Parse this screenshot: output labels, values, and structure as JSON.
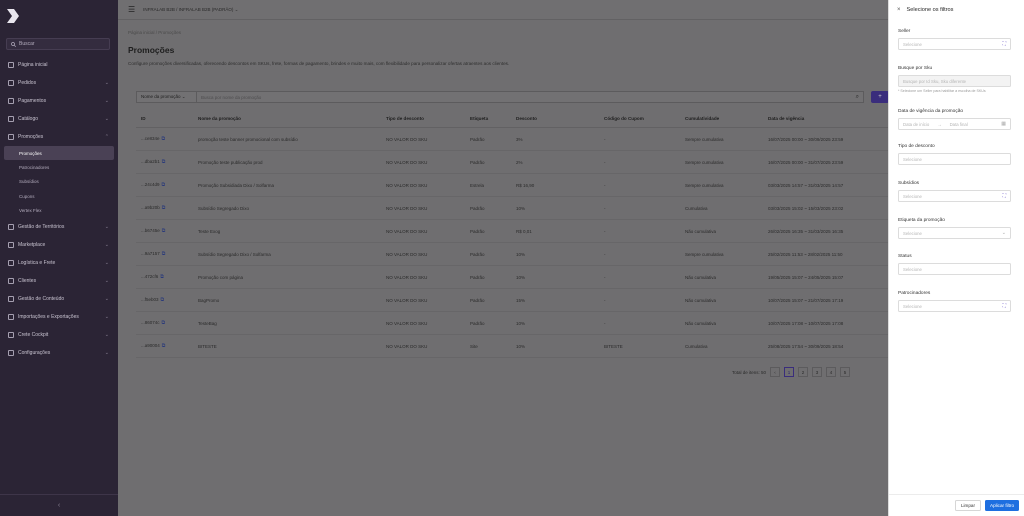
{
  "sidebar": {
    "search_label": "Buscar",
    "items": [
      {
        "label": "Página inicial",
        "icon": "home-icon",
        "chevron": false
      },
      {
        "label": "Pedidos",
        "icon": "receipt-icon",
        "chevron": true
      },
      {
        "label": "Pagamentos",
        "icon": "dollar-icon",
        "chevron": true
      },
      {
        "label": "Catálogo",
        "icon": "tag-icon",
        "chevron": true
      },
      {
        "label": "Promoções",
        "icon": "percent-icon",
        "chevron": true
      }
    ],
    "subitems": [
      {
        "label": "Promoções",
        "active": true
      },
      {
        "label": "Patrocinadores",
        "active": false
      },
      {
        "label": "Subsídios",
        "active": false
      },
      {
        "label": "Cupons",
        "active": false
      },
      {
        "label": "Vertex Flex",
        "active": false
      }
    ],
    "items2": [
      {
        "label": "Gestão de Territórios",
        "icon": "map-icon"
      },
      {
        "label": "Marketplace",
        "icon": "store-icon"
      },
      {
        "label": "Logística e Frete",
        "icon": "truck-icon"
      },
      {
        "label": "Clientes",
        "icon": "users-icon"
      },
      {
        "label": "Gestão de Conteúdo",
        "icon": "content-icon"
      },
      {
        "label": "Importações e Exportações",
        "icon": "file-icon"
      },
      {
        "label": "Crete Cockpit",
        "icon": "chat-icon"
      },
      {
        "label": "Configurações",
        "icon": "gear-icon"
      }
    ],
    "collapse_glyph": "‹"
  },
  "topbar": {
    "store_label": "INFRALAB B2B / INFRALAB B2B (PADRÃO) ⌄"
  },
  "page": {
    "breadcrumb": "Página inicial  /  Promoções",
    "title": "Promoções",
    "description": "Configure promoções diversificadas, oferecendo descontos em SKUs, frete, formas de pagamento, brindes e muito mais, com flexibilidade para personalizar ofertas atraentes aos clientes."
  },
  "filter": {
    "field_label": "Nome da promoção  ⌄",
    "placeholder": "Busca por nome da promoção",
    "search_glyph": "⌕",
    "button_glyph": "+"
  },
  "table": {
    "headers": [
      "ID",
      "Nome da promoção",
      "Tipo de desconto",
      "Etiqueta",
      "Desconto",
      "Código do Cupom",
      "Cumulatividade",
      "Data de vigência"
    ],
    "rows": [
      [
        "...ce834e",
        "promoção teste banner promocional com subsídio",
        "NO VALOR DO SKU",
        "Padrão",
        "3%",
        "-",
        "Sempre cumulativa",
        "16/07/2025 00:00 ~ 30/09/2025 23:59"
      ],
      [
        "...dba2b1",
        "Promoção teste publicação prod",
        "NO VALOR DO SKU",
        "Padrão",
        "2%",
        "-",
        "Sempre cumulativa",
        "16/07/2025 00:00 ~ 31/07/2025 23:59"
      ],
      [
        "...24c4d9",
        "Promoção Subsidiada Dixo / Solfarma",
        "NO VALOR DO SKU",
        "Estrela",
        "R$ 16,90",
        "-",
        "Sempre cumulativa",
        "03/03/2025 14:57 ~ 31/03/2025 14:57"
      ],
      [
        "...a9b20b",
        "Subsídio Segregado Dixo",
        "NO VALOR DO SKU",
        "Padrão",
        "10%",
        "-",
        "Cumulativa",
        "03/03/2025 15:02 ~ 15/03/2025 23:02"
      ],
      [
        "...b6745e",
        "Teste Exog",
        "NO VALOR DO SKU",
        "Padrão",
        "R$ 0,01",
        "-",
        "Não cumulativa",
        "26/02/2025 16:35 ~ 31/03/2025 16:35"
      ],
      [
        "...9a7157",
        "Subsídio Segregado Dixo / Solfarma",
        "NO VALOR DO SKU",
        "Padrão",
        "10%",
        "-",
        "Sempre cumulativa",
        "25/02/2025 11:53 ~ 28/02/2025 11:50"
      ],
      [
        "...472cf6",
        "Promoção com página",
        "NO VALOR DO SKU",
        "Padrão",
        "10%",
        "-",
        "Não cumulativa",
        "19/05/2025 15:07 ~ 24/05/2025 15:07"
      ],
      [
        "...f5eb03",
        "BagPromo",
        "NO VALOR DO SKU",
        "Padrão",
        "15%",
        "-",
        "Não cumulativa",
        "10/07/2025 15:07 ~ 21/07/2025 17:19"
      ],
      [
        "...86074c",
        "TesteBag",
        "NO VALOR DO SKU",
        "Padrão",
        "10%",
        "-",
        "Não cumulativa",
        "10/07/2025 17:08 ~ 10/07/2025 17:08"
      ],
      [
        "...a90004",
        "BITESTE",
        "NO VALOR DO SKU",
        "Site",
        "10%",
        "BITESTE",
        "Cumulativa",
        "25/08/2025 17:54 ~ 30/09/2025 18:54"
      ]
    ]
  },
  "pagination": {
    "total_label": "Total de itens: 50",
    "prev": "‹",
    "pages": [
      "1",
      "2",
      "3",
      "4",
      "5"
    ],
    "active_page": "1"
  },
  "drawer": {
    "title": "Selecione os filtros",
    "close_glyph": "×",
    "seller": {
      "label": "Seller",
      "placeholder": "Selecione"
    },
    "sku_search": {
      "label": "Busque por Sku",
      "placeholder": "Busque por Id Sku, Sku diferente",
      "hint": "* Selecione um Seller para habilitar a escolha de SKUs"
    },
    "validity": {
      "label": "Data de vigência da promoção",
      "start_placeholder": "Data de início",
      "end_placeholder": "Data final",
      "separator": "→"
    },
    "discount_type": {
      "label": "Tipo de desconto",
      "placeholder": "Selecione"
    },
    "subsidies": {
      "label": "Subsídios",
      "placeholder": "Selecione"
    },
    "promo_tag": {
      "label": "Etiqueta da promoção",
      "placeholder": "Selecione"
    },
    "status": {
      "label": "Status",
      "placeholder": "Selecione"
    },
    "sponsors": {
      "label": "Patrocinadores",
      "placeholder": "Selecione"
    },
    "clear_label": "Limpar",
    "apply_label": "Aplicar filtro"
  },
  "colors": {
    "sidebar_bg": "#2b2435",
    "accent": "#1e6fe0",
    "active_sub": "#4a4155"
  }
}
